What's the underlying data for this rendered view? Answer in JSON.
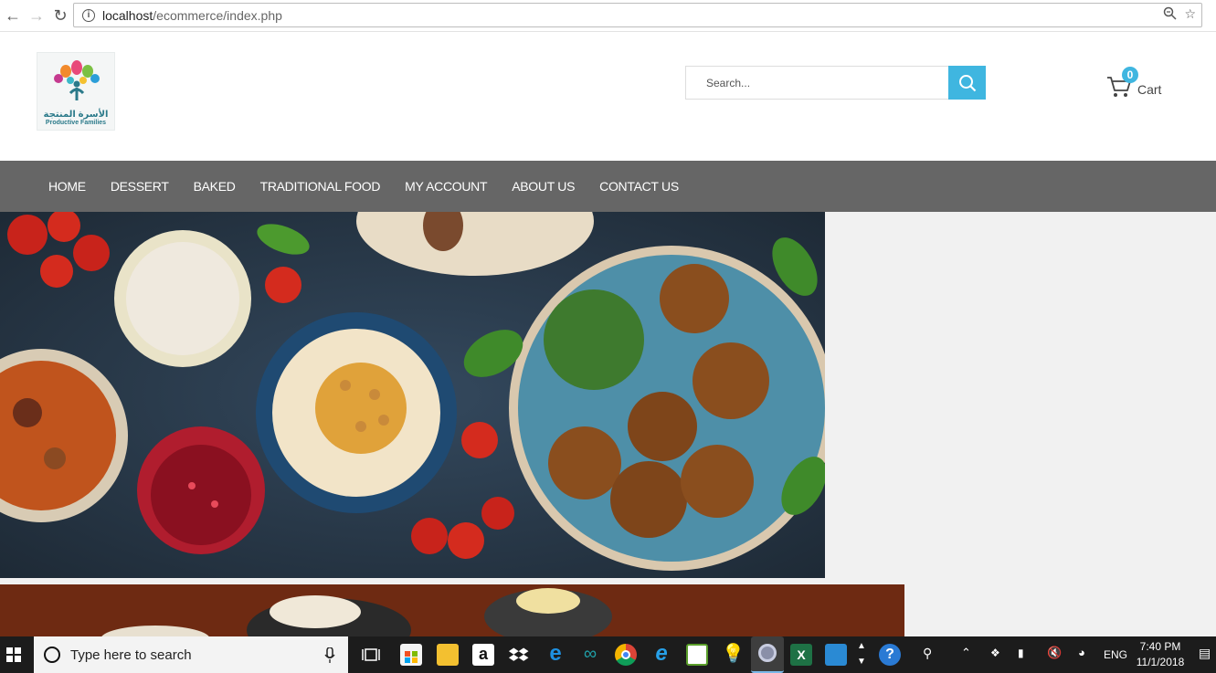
{
  "browser": {
    "url_host": "localhost",
    "url_path": "/ecommerce/index.php"
  },
  "header": {
    "logo_ar": "الأسرة المنتجة",
    "logo_en": "Productive Families",
    "search_placeholder": "Search...",
    "cart_count": "0",
    "cart_label": "Cart"
  },
  "nav": {
    "items": [
      {
        "label": "HOME"
      },
      {
        "label": "DESSERT"
      },
      {
        "label": "BAKED"
      },
      {
        "label": "TRADITIONAL FOOD"
      },
      {
        "label": "MY ACCOUNT"
      },
      {
        "label": "ABOUT US"
      },
      {
        "label": "CONTACT US"
      }
    ]
  },
  "colors": {
    "nav_bg": "#666666",
    "accent": "#3fb6e0",
    "content_bg": "#f1f1f1"
  },
  "taskbar": {
    "search_text": "Type here to search",
    "language": "ENG",
    "time": "7:40 PM",
    "date": "11/1/2018",
    "pinned_icons": [
      "task-view-icon",
      "store-icon",
      "file-explorer-icon",
      "amazon-icon",
      "dropbox-icon",
      "edge-icon",
      "arduino-icon",
      "chrome-icon",
      "ie-icon",
      "photo-icon",
      "bulb-icon",
      "chrome-active-icon",
      "excel-icon",
      "outlook-icon"
    ]
  }
}
